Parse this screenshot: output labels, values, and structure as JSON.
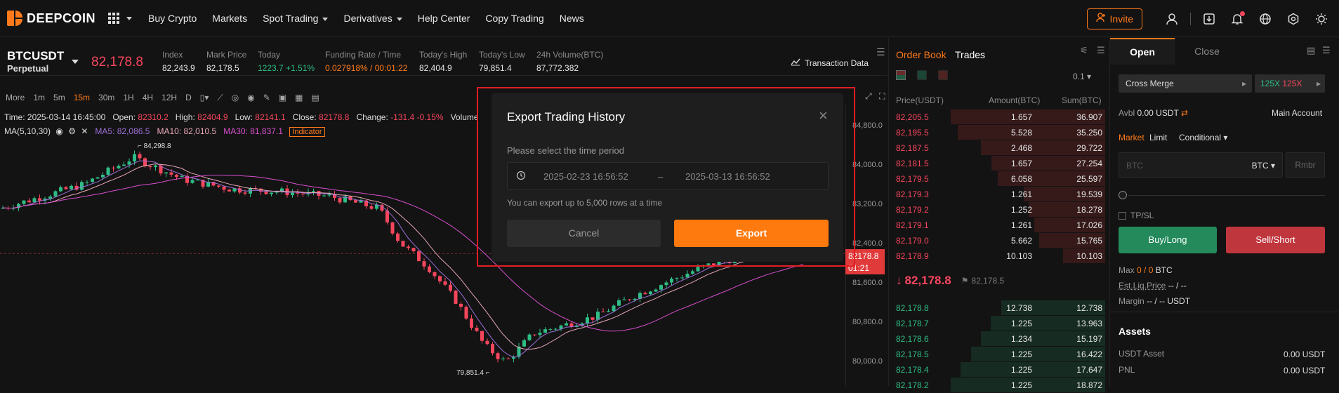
{
  "brand": {
    "name": "DEEPCOIN",
    "accent": "#ff7a1a"
  },
  "nav": {
    "items": [
      "Buy Crypto",
      "Markets",
      "Spot Trading",
      "Derivatives",
      "Help Center",
      "Copy Trading",
      "News"
    ],
    "invite_label": "Invite",
    "icons": [
      "user-icon",
      "download-icon",
      "bell-icon",
      "globe-icon",
      "settings-icon",
      "theme-icon"
    ]
  },
  "ticker": {
    "symbol": "BTCUSDT",
    "contract": "Perpetual",
    "last_price": "82,178.8",
    "stats": [
      {
        "label": "Index",
        "value": "82,243.9"
      },
      {
        "label": "Mark Price",
        "value": "82,178.5"
      },
      {
        "label": "Today",
        "value": "1223.7 +1.51%"
      },
      {
        "label": "Funding Rate / Time",
        "value": "0.027918% / 00:01:22"
      },
      {
        "label": "Today's High",
        "value": "82,404.9"
      },
      {
        "label": "Today's Low",
        "value": "79,851.4"
      },
      {
        "label": "24h Volume(BTC)",
        "value": "87,772.382"
      }
    ],
    "transaction_data": "Transaction Data"
  },
  "toolbar": {
    "more": "More",
    "timeframes": [
      "1m",
      "5m",
      "15m",
      "30m",
      "1H",
      "4H",
      "12H",
      "D"
    ],
    "active_timeframe": "15m"
  },
  "chart": {
    "ohlc": {
      "time": "Time: 2025-03-14 16:45:00",
      "open_label": "Open:",
      "open": "82310.2",
      "high_label": "High:",
      "high": "82404.9",
      "low_label": "Low:",
      "low": "82141.1",
      "close_label": "Close:",
      "close": "82178.8",
      "change_label": "Change:",
      "change": "-131.4 -0.15%",
      "volume_label": "Volume"
    },
    "ma": {
      "label": "MA(5,10,30)",
      "ma5": "MA5: 82,086.5",
      "ma10": "MA10: 82,010.5",
      "ma30": "MA30: 81,837.1",
      "indicator": "Indicator"
    },
    "high_marker": "84,298.8",
    "low_marker": "79,851.4",
    "axis": [
      "84,800.0",
      "84,000.0",
      "83,200.0",
      "82,400.0",
      "81,600.0",
      "80,800.0",
      "80,000.0"
    ],
    "current_price_tag": "82178.8",
    "countdown": "01:21"
  },
  "orderbook": {
    "tabs": [
      "Order Book",
      "Trades"
    ],
    "precision": "0.1",
    "headers": [
      "Price(USDT)",
      "Amount(BTC)",
      "Sum(BTC)"
    ],
    "asks": [
      [
        "82,205.5",
        "1.657",
        "36.907"
      ],
      [
        "82,195.5",
        "5.528",
        "35.250"
      ],
      [
        "82,187.5",
        "2.468",
        "29.722"
      ],
      [
        "82,181.5",
        "1.657",
        "27.254"
      ],
      [
        "82,179.5",
        "6.058",
        "25.597"
      ],
      [
        "82,179.3",
        "1.261",
        "19.539"
      ],
      [
        "82,179.2",
        "1.252",
        "18.278"
      ],
      [
        "82,179.1",
        "1.261",
        "17.026"
      ],
      [
        "82,179.0",
        "5.662",
        "15.765"
      ],
      [
        "82,178.9",
        "10.103",
        "10.103"
      ]
    ],
    "mid_price": "82,178.8",
    "mark_price": "82,178.5",
    "bids": [
      [
        "82,178.8",
        "12.738",
        "12.738"
      ],
      [
        "82,178.7",
        "1.225",
        "13.963"
      ],
      [
        "82,178.6",
        "1.234",
        "15.197"
      ],
      [
        "82,178.5",
        "1.225",
        "16.422"
      ],
      [
        "82,178.4",
        "1.225",
        "17.647"
      ],
      [
        "82,178.2",
        "1.225",
        "18.872"
      ]
    ]
  },
  "trade": {
    "tabs": [
      "Open",
      "Close"
    ],
    "margin_mode": "Cross Merge",
    "leverage_long": "125X",
    "leverage_short": "125X",
    "avbl_label": "Avbl",
    "avbl_value": "0.00 USDT",
    "main_account": "Main Account",
    "order_types": [
      "Market",
      "Limit",
      "Conditional"
    ],
    "amount_placeholder": "BTC",
    "unit": "BTC",
    "rmbr": "Rmbr",
    "tpsl": "TP/SL",
    "buy_label": "Buy/Long",
    "sell_label": "Sell/Short",
    "max_label": "Max",
    "max_values": "0 / 0",
    "max_unit": "BTC",
    "liq_label": "Est.Liq.Price",
    "liq_value": "-- / --",
    "margin_label": "Margin",
    "margin_value": "-- / -- USDT",
    "assets_title": "Assets",
    "usdt_asset_label": "USDT Asset",
    "usdt_asset_value": "0.00 USDT",
    "pnl_label": "PNL",
    "pnl_value": "0.00 USDT"
  },
  "modal": {
    "title": "Export Trading History",
    "prompt": "Please select the time period",
    "start": "2025-02-23 16:56:52",
    "separator": "–",
    "end": "2025-03-13 16:56:52",
    "note": "You can export up to 5,000 rows at a time",
    "cancel": "Cancel",
    "export": "Export"
  }
}
